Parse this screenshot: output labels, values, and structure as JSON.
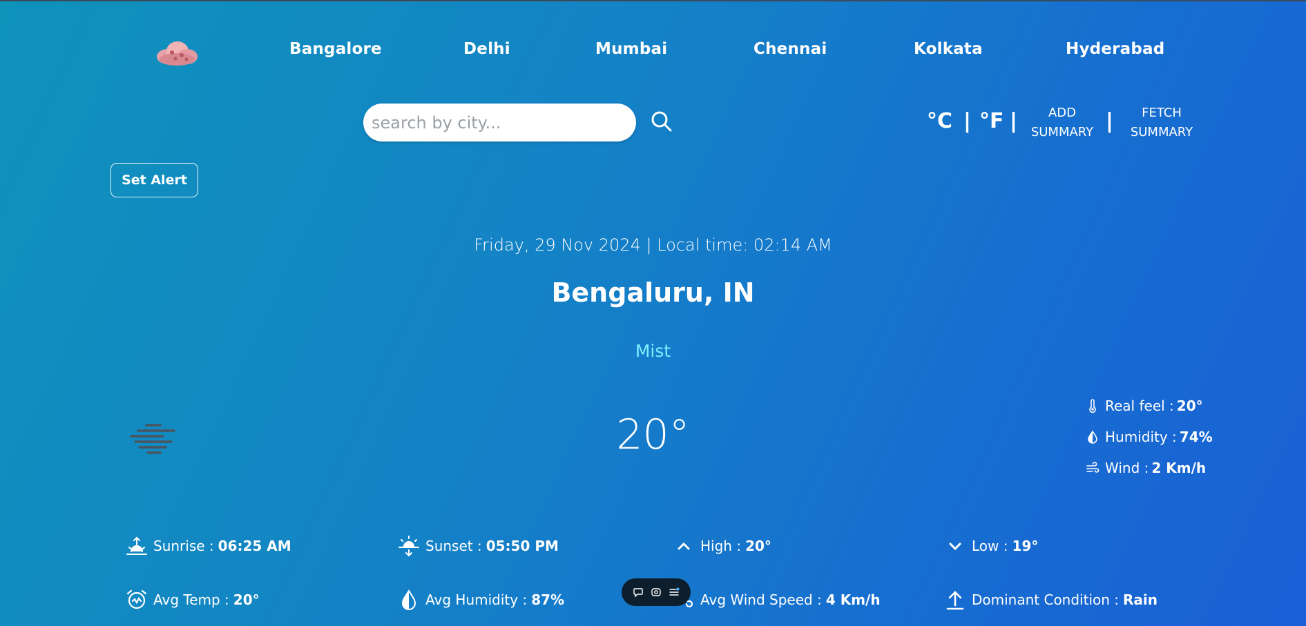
{
  "nav": {
    "logo": "cloud-logo",
    "cities": [
      "Bangalore",
      "Delhi",
      "Mumbai",
      "Chennai",
      "Kolkata",
      "Hyderabad"
    ]
  },
  "search": {
    "placeholder": "search by city..."
  },
  "units": {
    "celsius": "°C",
    "fahrenheit": "°F",
    "separator": "|"
  },
  "summary": {
    "add_line1": "ADD",
    "add_line2": "SUMMARY",
    "fetch_line1": "FETCH",
    "fetch_line2": "SUMMARY"
  },
  "alert": {
    "label": "Set Alert"
  },
  "weather": {
    "datetime": "Friday, 29 Nov 2024 | Local time: 02:14 AM",
    "location": "Bengaluru, IN",
    "condition": "Mist",
    "temperature": "20°",
    "real_feel_label": "Real feel :",
    "real_feel_value": "20°",
    "humidity_label": "Humidity :",
    "humidity_value": "74%",
    "wind_label": "Wind :",
    "wind_value": "2 Km/h"
  },
  "stats": {
    "sunrise_label": "Sunrise :",
    "sunrise_value": "06:25 AM",
    "sunset_label": "Sunset :",
    "sunset_value": "05:50 PM",
    "high_label": "High :",
    "high_value": "20°",
    "low_label": "Low :",
    "low_value": "19°",
    "avg_temp_label": "Avg Temp :",
    "avg_temp_value": "20°",
    "avg_humidity_label": "Avg Humidity :",
    "avg_humidity_value": "87%",
    "avg_wind_label": "Avg Wind Speed :",
    "avg_wind_value": "4 Km/h",
    "dominant_label": "Dominant Condition :",
    "dominant_value": "Rain"
  },
  "colors": {
    "condition_text": "#7ff0ff",
    "bg_start": "#0e93bb",
    "bg_end": "#1a5fd6"
  }
}
